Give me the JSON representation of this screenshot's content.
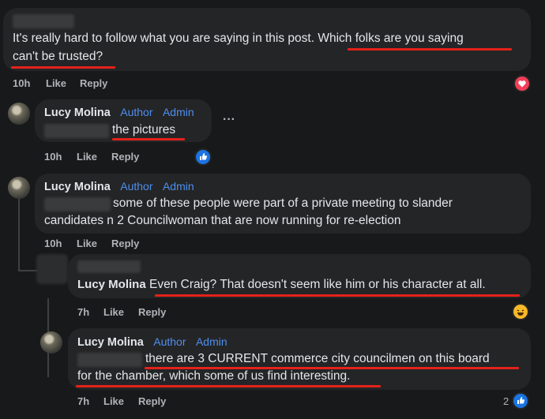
{
  "comment1": {
    "text_a": "It's really hard to follow what you are saying in this post. ",
    "text_b": "Which folks are you saying",
    "text_c": "can't be trusted?",
    "time": "10h",
    "like": "Like",
    "reply": "Reply",
    "reaction": "heart-reaction",
    "reaction_color": "#f33e58"
  },
  "comment2": {
    "author": "Lucy Molina",
    "badge_author": "Author",
    "badge_admin": "Admin",
    "text": "the pictures",
    "more": "···",
    "time": "10h",
    "like": "Like",
    "reply": "Reply",
    "reaction": "like-reaction",
    "reaction_color": "#1b74e4"
  },
  "comment3": {
    "author": "Lucy Molina",
    "badge_author": "Author",
    "badge_admin": "Admin",
    "text_a": "some of these people were part of a private meeting to slander",
    "text_b": "candidates n 2 Councilwoman that are now running for re-election",
    "time": "10h",
    "like": "Like",
    "reply": "Reply"
  },
  "reply1": {
    "author": "Lucy Molina",
    "text": "Even Craig? That doesn't seem like him or his character at all.",
    "time": "7h",
    "like": "Like",
    "reply": "Reply",
    "reaction": "laugh-reaction",
    "reaction_color": "#f7b928"
  },
  "reply2": {
    "author": "Lucy Molina",
    "badge_author": "Author",
    "badge_admin": "Admin",
    "text_a": "there are 3 CURRENT commerce city councilmen on this board",
    "text_b": "for the chamber, which some of us find interesting.",
    "time": "7h",
    "like": "Like",
    "reply": "Reply",
    "reaction_count": "2",
    "reaction": "like-reaction",
    "reaction_color": "#1b74e4"
  },
  "annotation_color": "#e4221b"
}
